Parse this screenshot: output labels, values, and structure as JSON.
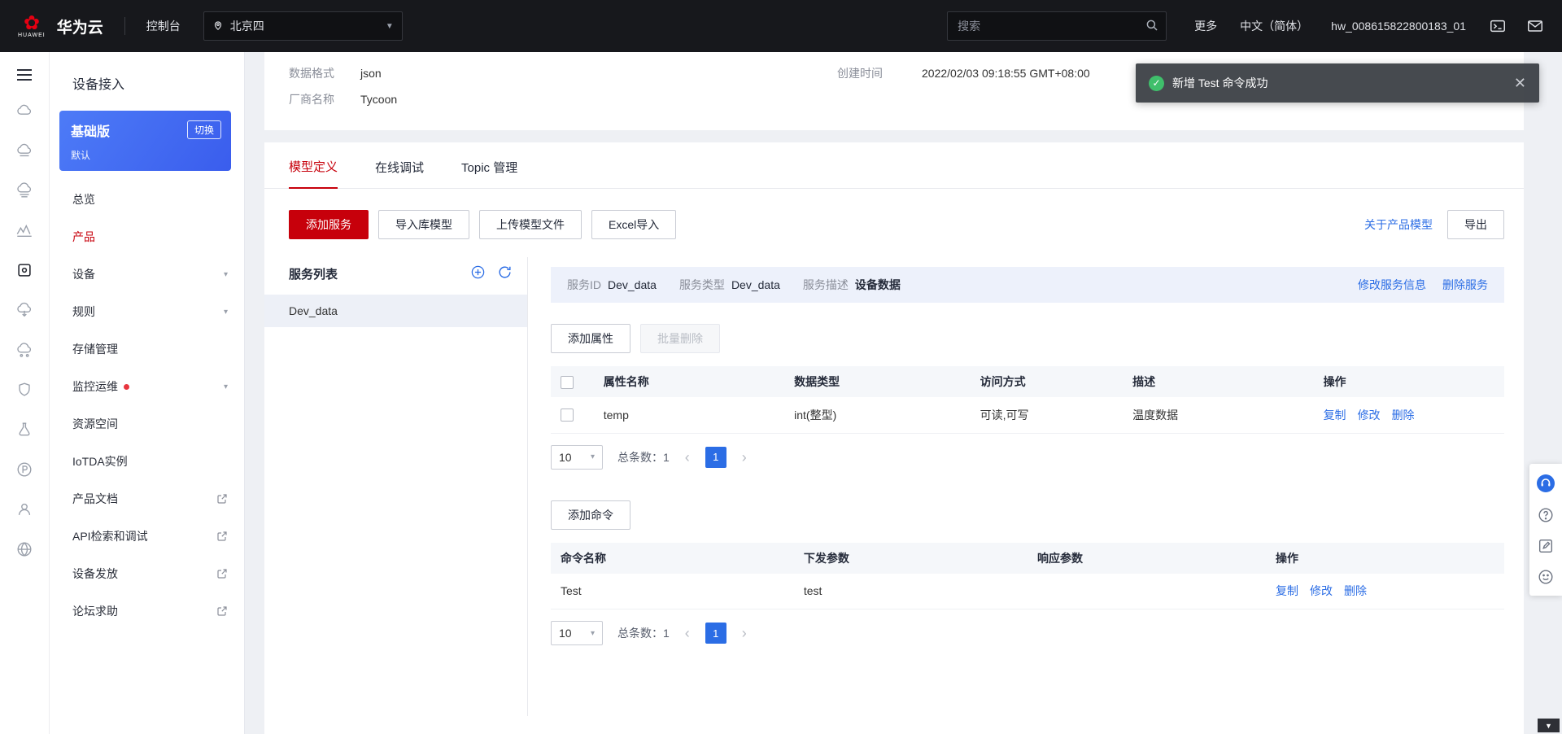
{
  "topbar": {
    "logo_text": "HUAWEI",
    "brand": "华为云",
    "console_label": "控制台",
    "region": "北京四",
    "search_placeholder": "搜索",
    "more_label": "更多",
    "language": "中文（简体）",
    "account": "hw_008615822800183_01"
  },
  "sidebar": {
    "title": "设备接入",
    "edition": {
      "name": "基础版",
      "switch_label": "切换",
      "instance": "默认"
    },
    "items": [
      {
        "label": "总览"
      },
      {
        "label": "产品"
      },
      {
        "label": "设备"
      },
      {
        "label": "规则"
      },
      {
        "label": "存储管理"
      },
      {
        "label": "监控运维"
      },
      {
        "label": "资源空间"
      },
      {
        "label": "IoTDA实例"
      },
      {
        "label": "产品文档"
      },
      {
        "label": "API检索和调试"
      },
      {
        "label": "设备发放"
      },
      {
        "label": "论坛求助"
      }
    ]
  },
  "toast": {
    "message": "新增 Test 命令成功"
  },
  "product_info": {
    "data_format_label": "数据格式",
    "data_format": "json",
    "vendor_label": "厂商名称",
    "vendor": "Tycoon",
    "created_label": "创建时间",
    "created": "2022/02/03 09:18:55 GMT+08:00"
  },
  "tabs": [
    {
      "label": "模型定义"
    },
    {
      "label": "在线调试"
    },
    {
      "label": "Topic 管理"
    }
  ],
  "model_toolbar": {
    "add_service": "添加服务",
    "import_library": "导入库模型",
    "upload_file": "上传模型文件",
    "excel_import": "Excel导入",
    "about_link": "关于产品模型",
    "export": "导出"
  },
  "service_list": {
    "title": "服务列表",
    "items": [
      {
        "name": "Dev_data"
      }
    ]
  },
  "service_detail": {
    "id_label": "服务ID",
    "id_value": "Dev_data",
    "type_label": "服务类型",
    "type_value": "Dev_data",
    "desc_label": "服务描述",
    "desc_value": "设备数据",
    "edit_link": "修改服务信息",
    "delete_link": "删除服务"
  },
  "properties": {
    "add_button": "添加属性",
    "batch_delete_button": "批量删除",
    "columns": {
      "name": "属性名称",
      "type": "数据类型",
      "access": "访问方式",
      "desc": "描述",
      "ops": "操作"
    },
    "rows": [
      {
        "name": "temp",
        "type": "int(整型)",
        "access": "可读,可写",
        "desc": "温度数据"
      }
    ],
    "row_actions": {
      "copy": "复制",
      "edit": "修改",
      "delete": "删除"
    }
  },
  "commands": {
    "add_button": "添加命令",
    "columns": {
      "name": "命令名称",
      "down": "下发参数",
      "response": "响应参数",
      "ops": "操作"
    },
    "rows": [
      {
        "name": "Test",
        "down": "test",
        "response": ""
      }
    ],
    "row_actions": {
      "copy": "复制",
      "edit": "修改",
      "delete": "删除"
    }
  },
  "pagination": {
    "page_size": "10",
    "total_label": "总条数：",
    "total": "1",
    "current_page": "1"
  },
  "colors": {
    "accent_red": "#c7000b",
    "link_blue": "#2b6de5",
    "toast_green": "#3fbf6b"
  }
}
